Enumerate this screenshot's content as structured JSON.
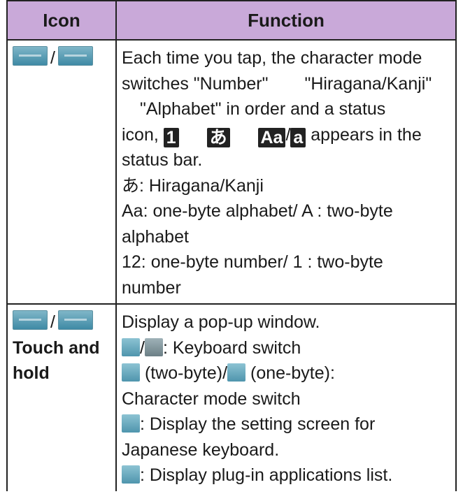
{
  "header": {
    "icon": "Icon",
    "function": "Function"
  },
  "row1": {
    "separator": "/",
    "line1": "Each time you tap, the character mode",
    "line2a": "switches \"Number\"",
    "line2b": "\"Hiragana/Kanji\"",
    "line3": "\"Alphabet\" in order and a status",
    "line4a": "icon,",
    "status_number": "1",
    "status_hiragana": "あ",
    "status_alpha_wide": "Aa",
    "status_alpha_narrow": "a",
    "line4b": "appears in the",
    "line5": "status bar.",
    "hiragana_glyph": "あ",
    "hiragana_label": ": Hiragana/Kanji",
    "alpha_line": "Aa: one-byte alphabet/ A : two-byte",
    "alpha_line_cont": "alphabet",
    "number_line": "12: one-byte number/ 1 : two-byte",
    "number_line_cont": "number"
  },
  "row2": {
    "separator": "/",
    "touch_label_1": "Touch and",
    "touch_label_2": "hold",
    "line1": "Display a pop-up window.",
    "keyboard_switch": ": Keyboard switch",
    "two_byte": "(two-byte)/",
    "one_byte": "(one-byte):",
    "char_mode_switch": "Character mode switch",
    "setting_line1": ": Display the setting screen for",
    "setting_line2": "Japanese keyboard.",
    "plugin_line": ": Display plug-in applications list."
  },
  "icons": [
    "character-mode-icon",
    "keyboard-icon",
    "two-byte-icon",
    "one-byte-icon",
    "settings-icon",
    "plug-in-icon"
  ],
  "colors": {
    "header_bg": "#c9a9d9",
    "border": "#222222",
    "icon_blue": "#4f95ad"
  }
}
